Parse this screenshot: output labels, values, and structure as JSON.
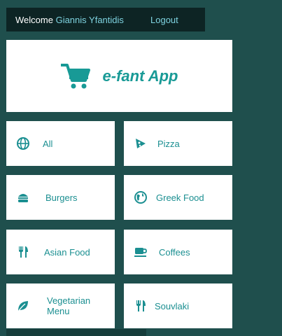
{
  "topbar": {
    "welcome_label": "Welcome",
    "user_name": "Giannis Yfantidis",
    "logout_label": "Logout"
  },
  "brand": {
    "title": "e-fant App",
    "icon": "shopping-cart-icon"
  },
  "categories": [
    {
      "label": "All",
      "icon": "globe-icon"
    },
    {
      "label": "Pizza",
      "icon": "pizza-slice-icon"
    },
    {
      "label": "Burgers",
      "icon": "burger-icon"
    },
    {
      "label": "Greek Food",
      "icon": "globe-americas-icon"
    },
    {
      "label": "Asian Food",
      "icon": "utensils-icon"
    },
    {
      "label": "Coffees",
      "icon": "coffee-cup-icon"
    },
    {
      "label": "Vegetarian Menu",
      "icon": "leaf-icon"
    },
    {
      "label": "Souvlaki",
      "icon": "utensils-icon"
    }
  ],
  "colors": {
    "background": "#1f4f4d",
    "topbar": "#0d2424",
    "accent": "#189a96",
    "link": "#7fd3e0",
    "tile_text": "#1b8f91"
  }
}
